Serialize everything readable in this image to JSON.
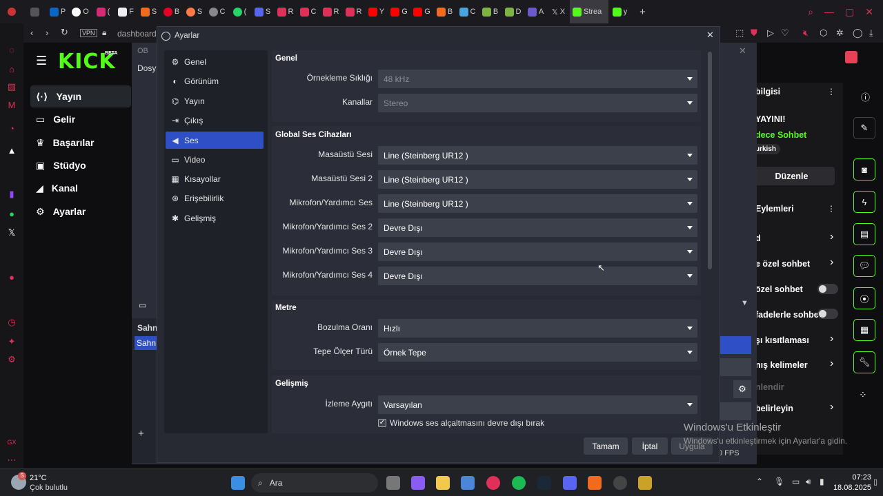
{
  "browser": {
    "tabs": [
      "P",
      "O",
      "(",
      "F",
      "S",
      "B",
      "S",
      "C",
      "(",
      "S",
      "R",
      "C",
      "R",
      "R",
      "Y",
      "G",
      "G",
      "B",
      "C",
      "B",
      "D",
      "A",
      "X"
    ],
    "active_tab": "Strea",
    "extra_tab": "y",
    "address": "dashboard",
    "vpn_label": "VPN"
  },
  "kick": {
    "logo": "KICK",
    "beta": "BETA",
    "nav": [
      "Yayın",
      "Gelir",
      "Başarılar",
      "Stüdyo",
      "Kanal",
      "Ayarlar"
    ],
    "right_panel": {
      "info_title": "bilgisi",
      "stream_title": "YAYINI!",
      "chat_mode": "dece Sohbet",
      "tag": "urkish",
      "edit_button": "Düzenle",
      "actions_title": "Eylemleri",
      "action_items": [
        "d",
        "e özel sohbet",
        "özel sohbet",
        "fadelerle sohbet",
        "şı kısıtlaması",
        "nış kelimeler",
        "nlendir",
        "belirleyin"
      ]
    }
  },
  "obs_main": {
    "title": "OB",
    "menu": "Dosya",
    "scenes_label": "Sahn",
    "scene_item": "Sahn",
    "fps": "0 FPS"
  },
  "settings": {
    "title": "Ayarlar",
    "nav": [
      {
        "label": "Genel",
        "icon": "gear-icon",
        "selected": false
      },
      {
        "label": "Görünüm",
        "icon": "palette-icon",
        "selected": false
      },
      {
        "label": "Yayın",
        "icon": "antenna-icon",
        "selected": false
      },
      {
        "label": "Çıkış",
        "icon": "output-icon",
        "selected": false
      },
      {
        "label": "Ses",
        "icon": "speaker-icon",
        "selected": true
      },
      {
        "label": "Video",
        "icon": "monitor-icon",
        "selected": false
      },
      {
        "label": "Kısayollar",
        "icon": "keyboard-icon",
        "selected": false
      },
      {
        "label": "Erişebilirlik",
        "icon": "accessibility-icon",
        "selected": false
      },
      {
        "label": "Gelişmiş",
        "icon": "wrench-icon",
        "selected": false
      }
    ],
    "sections": {
      "general": {
        "title": "Genel",
        "rows": [
          {
            "label": "Örnekleme Sıklığı",
            "value": "48 kHz",
            "disabled": true
          },
          {
            "label": "Kanallar",
            "value": "Stereo",
            "disabled": true
          }
        ]
      },
      "global_audio": {
        "title": "Global Ses Cihazları",
        "rows": [
          {
            "label": "Masaüstü Sesi",
            "value": "Line (Steinberg UR12 )"
          },
          {
            "label": "Masaüstü Sesi 2",
            "value": "Line (Steinberg UR12 )"
          },
          {
            "label": "Mikrofon/Yardımcı Ses",
            "value": "Line (Steinberg UR12 )"
          },
          {
            "label": "Mikrofon/Yardımcı Ses 2",
            "value": "Devre Dışı"
          },
          {
            "label": "Mikrofon/Yardımcı Ses 3",
            "value": "Devre Dışı"
          },
          {
            "label": "Mikrofon/Yardımcı Ses 4",
            "value": "Devre Dışı"
          }
        ]
      },
      "meters": {
        "title": "Metre",
        "rows": [
          {
            "label": "Bozulma Oranı",
            "value": "Hızlı"
          },
          {
            "label": "Tepe Ölçer Türü",
            "value": "Örnek Tepe"
          }
        ]
      },
      "advanced": {
        "title": "Gelişmiş",
        "rows": [
          {
            "label": "İzleme Aygıtı",
            "value": "Varsayılan"
          }
        ],
        "checkbox_label": "Windows ses alçaltmasını devre dışı bırak",
        "checkbox_checked": true
      }
    },
    "buttons": {
      "ok": "Tamam",
      "cancel": "İptal",
      "apply": "Uygula"
    }
  },
  "windows": {
    "watermark_title": "Windows'u Etkinleştir",
    "watermark_text": "Windows'u etkinleştirmek için Ayarlar'a gidin."
  },
  "taskbar": {
    "weather_temp": "21°C",
    "weather_text": "Çok bulutlu",
    "search": "Ara",
    "time": "07:23",
    "date": "18.08.2025",
    "badge": "S"
  },
  "colors": {
    "accent": "#2f4fc6",
    "kick_green": "#53fc18",
    "opera_red": "#e0305a"
  }
}
